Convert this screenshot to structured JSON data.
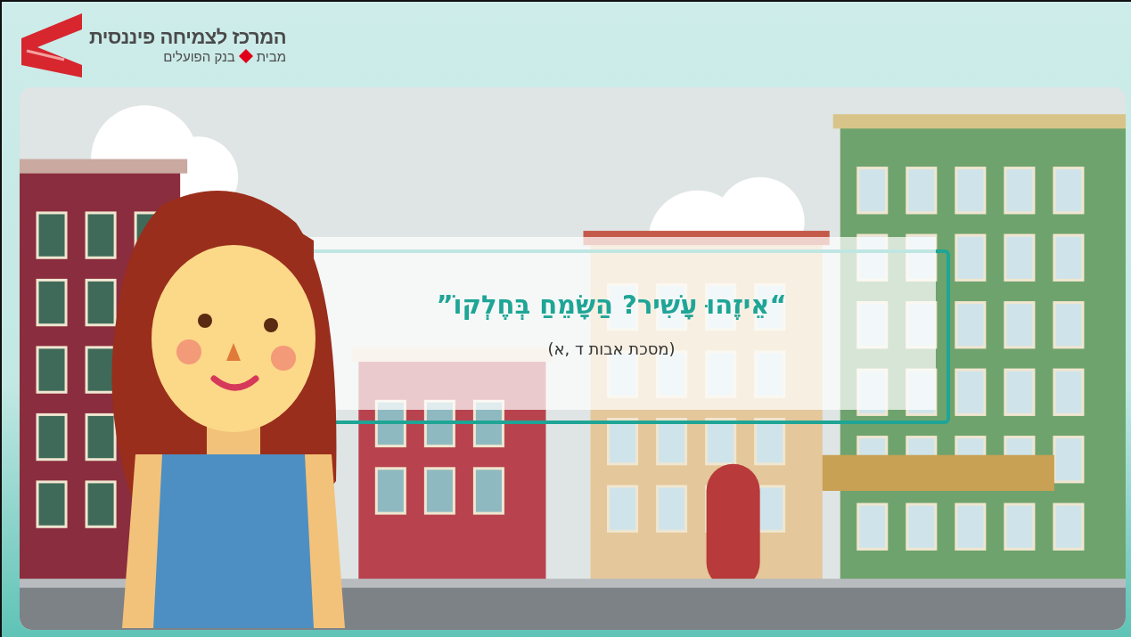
{
  "logo": {
    "title": "המרכז לצמיחה פיננסית",
    "from": "מבית",
    "bank": "בנק הפועלים"
  },
  "slide": {
    "quote": "“אֵיזֶהוּ עָשִׁיר? הַשָּׂמֵחַ בְּחֶלְקוֹ”",
    "source": "(מסכת אבות ד ,א)"
  }
}
